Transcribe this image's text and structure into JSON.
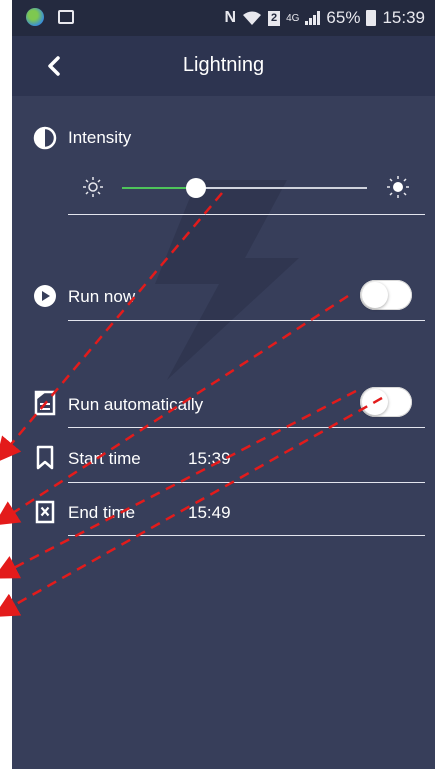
{
  "status_bar": {
    "network_label": "4G",
    "battery_percent": "65%",
    "time": "15:39"
  },
  "app_bar": {
    "title": "Lightning",
    "back_icon": "chevron-left-icon"
  },
  "intensity": {
    "label": "Intensity",
    "icon": "contrast-icon",
    "level": 0.3
  },
  "run_now": {
    "label": "Run now",
    "icon": "play-circle-icon",
    "enabled": false
  },
  "run_automatically": {
    "label": "Run automatically",
    "icon": "schedule-note-icon",
    "enabled": false
  },
  "start_time": {
    "label": "Start time",
    "icon": "bookmark-icon",
    "value": "15:39"
  },
  "end_time": {
    "label": "End time",
    "icon": "bookmark-x-icon",
    "value": "15:49"
  },
  "colors": {
    "background": "#373e5a",
    "app_bar": "#2d3450",
    "status_bar": "#242a3f",
    "slider_active": "#4ec45a",
    "annotation": "#e31b1b"
  }
}
